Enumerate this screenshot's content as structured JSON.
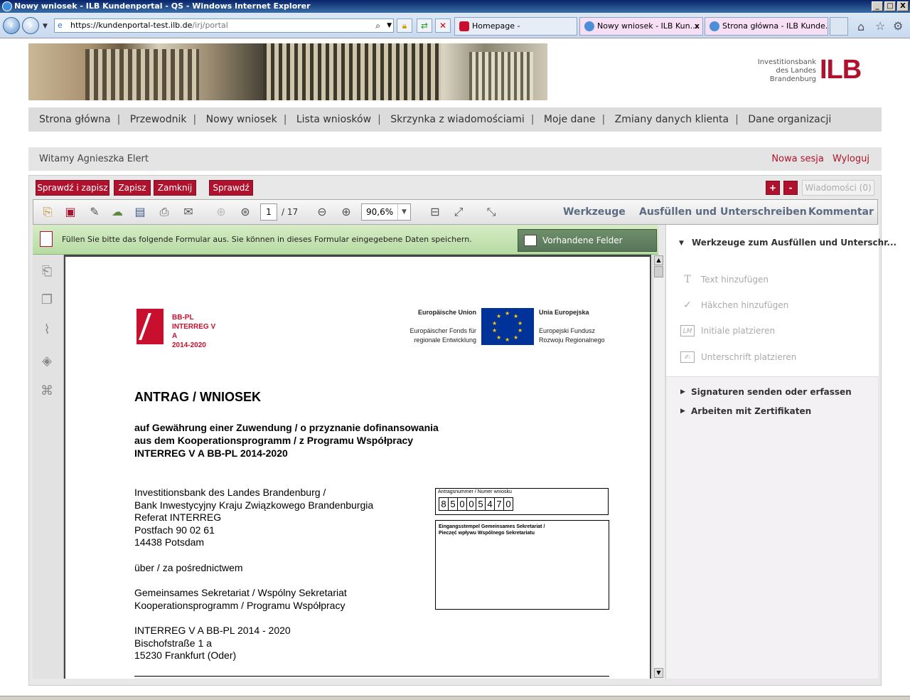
{
  "window": {
    "title": "Nowy wniosek - ILB Kundenportal - QS - Windows Internet Explorer",
    "min": "_",
    "max": "□",
    "close": "X"
  },
  "browser": {
    "url_host": "https://kundenportal-test.ilb.de",
    "url_path": "/irj/portal",
    "tabs": [
      {
        "label": "Homepage -"
      },
      {
        "label": "Nowy wniosek - ILB Kun..."
      },
      {
        "label": "Strona główna - ILB Kunde..."
      }
    ],
    "tab_close": "x"
  },
  "brand": {
    "bank_name": "Investitionsbank\ndes Landes\nBrandenburg",
    "logo": "ILB",
    "accent": "#b0122e"
  },
  "main_nav": [
    "Strona główna",
    "Przewodnik",
    "Nowy wniosek",
    "Lista wniosków",
    "Skrzynka z wiadomościami",
    "Moje dane",
    "Zmiany danych klienta",
    "Dane organizacji"
  ],
  "welcome": {
    "text": "Witamy Agnieszka Elert",
    "new_session": "Nowa sesja",
    "logout": "Wyloguj"
  },
  "actions": {
    "check_save": "Sprawdź i zapisz",
    "save": "Zapisz",
    "close": "Zamknij",
    "check": "Sprawdź",
    "plus": "+",
    "minus": "-",
    "messages": "Wiadomości (0)"
  },
  "pdf": {
    "page": "1",
    "total": "/ 17",
    "zoom": "90,6%",
    "tools": "Werkzeuge",
    "fill_sign": "Ausfüllen und Unterschreiben",
    "comment": "Kommentar",
    "info": "Füllen Sie bitte das folgende Formular aus. Sie können in dieses Formular eingegebene Daten speichern.",
    "mark_fields": "Vorhandene Felder markieren"
  },
  "document": {
    "program_logo": "BB-PL\nINTERREG V A\n2014-2020",
    "eu_de_title": "Europäische Union",
    "eu_de_fund": "Europäischer Fonds für\nregionale Entwicklung",
    "eu_pl_title": "Unia Europejska",
    "eu_pl_fund": "Europejski Fundusz\nRozwoju Regionalnego",
    "title": "ANTRAG / WNIOSEK",
    "subtitle": "auf Gewährung einer Zuwendung / o przyznanie dofinansowania\naus dem Kooperationsprogramm / z Programu Współpracy\nINTERREG V A BB-PL 2014-2020",
    "address1": "Investitionsbank des Landes Brandenburg /\nBank Inwestycyjny Kraju Związkowego Brandenburgia\nReferat INTERREG\nPostfach 90 02 61\n14438 Potsdam",
    "via": "über / za pośrednictwem",
    "address2": "Gemeinsames Sekretariat / Wspólny Sekretariat\nKooperationsprogramm / Programu Współpracy",
    "address3": "INTERREG V A BB-PL 2014 - 2020\nBischofstraße 1 a\n15230 Frankfurt (Oder)",
    "number_label": "Antragsnummer / Numer wniosku",
    "number_digits": [
      "8",
      "5",
      "0",
      "0",
      "5",
      "4",
      "7",
      "0"
    ],
    "stamp_label": "Eingangsstempel Gemeinsames Sekretariat /\nPieczęć wpływu Wspólnego Sekretariatu"
  },
  "right_panel": {
    "header": "Werkzeuge zum Ausfüllen und Unterschr...",
    "items": [
      "Text hinzufügen",
      "Häkchen hinzufügen",
      "Initiale platzieren",
      "Unterschrift platzieren"
    ],
    "sections": [
      "Signaturen senden oder erfassen",
      "Arbeiten mit Zertifikaten"
    ]
  }
}
